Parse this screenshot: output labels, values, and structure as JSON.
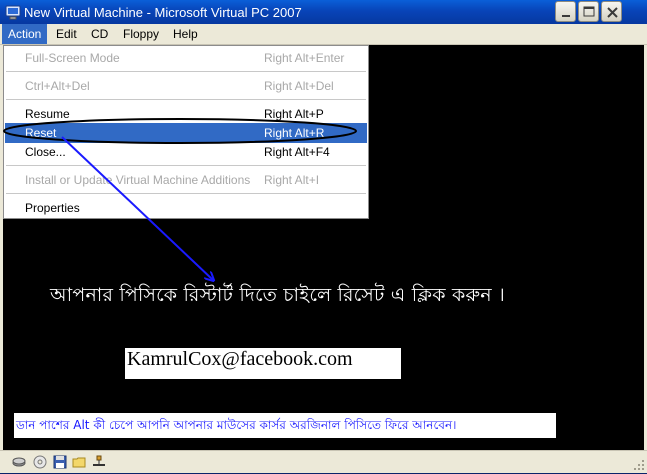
{
  "window": {
    "title": "New Virtual Machine - Microsoft Virtual PC 2007"
  },
  "menubar": {
    "items": [
      {
        "label": "Action"
      },
      {
        "label": "Edit"
      },
      {
        "label": "CD"
      },
      {
        "label": "Floppy"
      },
      {
        "label": "Help"
      }
    ]
  },
  "action_menu": {
    "full_screen": {
      "label": "Full-Screen Mode",
      "shortcut": "Right Alt+Enter"
    },
    "ctrl_alt_del": {
      "label": "Ctrl+Alt+Del",
      "shortcut": "Right Alt+Del"
    },
    "resume": {
      "label": "Resume",
      "shortcut": "Right Alt+P"
    },
    "reset": {
      "label": "Reset",
      "shortcut": "Right Alt+R"
    },
    "close": {
      "label": "Close...",
      "shortcut": "Right Alt+F4"
    },
    "install": {
      "label": "Install or Update Virtual Machine Additions",
      "shortcut": "Right Alt+I"
    },
    "properties": {
      "label": "Properties"
    }
  },
  "screen": {
    "instruction": "আপনার পিসিকে রিস্টার্ট দিতে চাইলে রিসেট এ ক্লিক করুন ।",
    "email": "KamrulCox@facebook.com",
    "note": "ডান পাশের Alt কী চেপে আপনি আপনার মাউসের কার্সর অরজিনাল পিসিতে ফিরে আনবেন।"
  },
  "colors": {
    "title_bar": "#0844b8",
    "menu_highlight": "#316ac5",
    "annotation": "#1a1aff",
    "note_text": "#1515ff"
  },
  "status_icons": [
    "hard-disk-icon",
    "cd-icon",
    "floppy-icon",
    "folder-icon",
    "network-icon"
  ]
}
